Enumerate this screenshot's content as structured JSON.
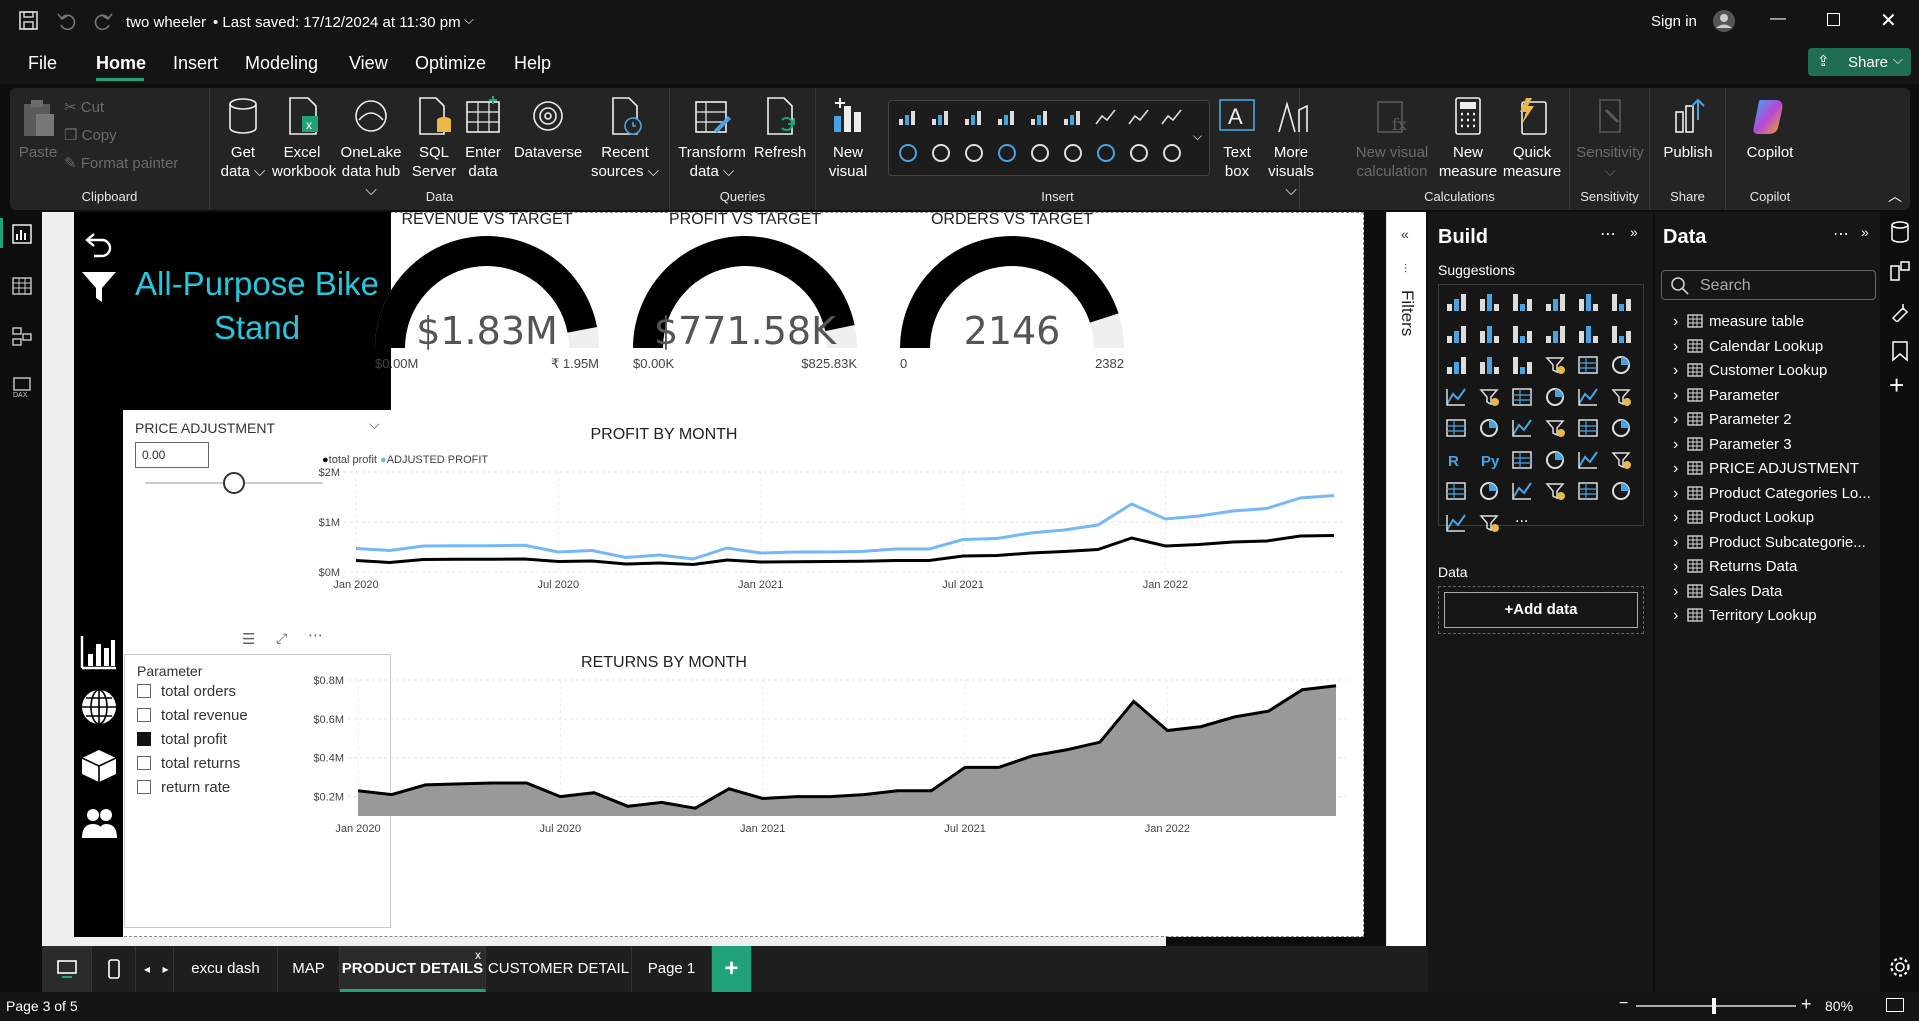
{
  "titlebar": {
    "file_name": "two wheeler",
    "saved": "• Last saved: 17/12/2024 at 11:30 pm",
    "sign_in": "Sign in"
  },
  "menu": {
    "items": [
      "File",
      "Home",
      "Insert",
      "Modeling",
      "View",
      "Optimize",
      "Help"
    ],
    "active": "Home",
    "share": "Share"
  },
  "ribbon": {
    "clipboard": {
      "paste": "Paste",
      "cut": "Cut",
      "copy": "Copy",
      "format_painter": "Format painter",
      "label": "Clipboard"
    },
    "data": {
      "get_data": [
        "Get",
        "data"
      ],
      "excel": [
        "Excel",
        "workbook"
      ],
      "onelake": [
        "OneLake",
        "data hub"
      ],
      "sql": [
        "SQL",
        "Server"
      ],
      "enter": [
        "Enter",
        "data"
      ],
      "dataverse": "Dataverse",
      "recent": [
        "Recent",
        "sources"
      ],
      "label": "Data"
    },
    "queries": {
      "transform": [
        "Transform",
        "data"
      ],
      "refresh": "Refresh",
      "label": "Queries"
    },
    "insert": {
      "new_visual": [
        "New",
        "visual"
      ],
      "text_box": [
        "Text",
        "box"
      ],
      "more_visuals": [
        "More",
        "visuals"
      ],
      "label": "Insert"
    },
    "calculations": {
      "new_visual_calc": [
        "New visual",
        "calculation"
      ],
      "new_measure": [
        "New",
        "measure"
      ],
      "quick_measure": [
        "Quick",
        "measure"
      ],
      "label": "Calculations"
    },
    "sensitivity": {
      "btn": "Sensitivity",
      "label": "Sensitivity"
    },
    "share": {
      "publish": "Publish",
      "label": "Share"
    },
    "copilot": {
      "btn": "Copilot",
      "label": "Copilot"
    }
  },
  "report": {
    "product_title": "All-Purpose Bike Stand",
    "slicer": {
      "title": "PRICE ADJUSTMENT",
      "value": "0.00",
      "level": 0.5
    },
    "parameter": {
      "title": "Parameter",
      "options": [
        {
          "label": "total orders",
          "checked": false
        },
        {
          "label": "total revenue",
          "checked": false
        },
        {
          "label": "total profit",
          "checked": true
        },
        {
          "label": "total returns",
          "checked": false
        },
        {
          "label": "return rate",
          "checked": false
        }
      ]
    },
    "gauges": [
      {
        "title": "REVENUE VS TARGET",
        "value_text": "$1.83M",
        "min": "$0.00M",
        "max": "₹ 1.95M",
        "fraction": 0.94
      },
      {
        "title": "PROFIT VS TARGET",
        "value_text": "$771.58K",
        "min": "$0.00K",
        "max": "$825.83K",
        "fraction": 0.934
      },
      {
        "title": "ORDERS VS TARGET",
        "value_text": "2146",
        "min": "0",
        "max": "2382",
        "fraction": 0.9
      }
    ]
  },
  "chart_data": [
    {
      "type": "line",
      "title": "PROFIT BY MONTH",
      "x": [
        "Jan 2020",
        "Feb 2020",
        "Mar 2020",
        "Apr 2020",
        "May 2020",
        "Jun 2020",
        "Jul 2020",
        "Aug 2020",
        "Sep 2020",
        "Oct 2020",
        "Nov 2020",
        "Dec 2020",
        "Jan 2021",
        "Feb 2021",
        "Mar 2021",
        "Apr 2021",
        "May 2021",
        "Jun 2021",
        "Jul 2021",
        "Aug 2021",
        "Sep 2021",
        "Oct 2021",
        "Nov 2021",
        "Dec 2021",
        "Jan 2022",
        "Feb 2022",
        "Mar 2022",
        "Apr 2022",
        "May 2022",
        "Jun 2022"
      ],
      "x_ticks": [
        "Jan 2020",
        "Jul 2020",
        "Jan 2021",
        "Jul 2021",
        "Jan 2022"
      ],
      "y_ticks": [
        "$0M",
        "$1M",
        "$2M"
      ],
      "ylim": [
        0,
        2000000
      ],
      "legend_position": "top-left",
      "series": [
        {
          "name": "total profit",
          "color": "#000000",
          "values": [
            230000,
            190000,
            250000,
            255000,
            255000,
            260000,
            210000,
            220000,
            160000,
            180000,
            150000,
            240000,
            200000,
            205000,
            210000,
            215000,
            230000,
            230000,
            320000,
            330000,
            380000,
            410000,
            450000,
            680000,
            520000,
            550000,
            600000,
            620000,
            720000,
            730000
          ]
        },
        {
          "name": "ADJUSTED PROFIT",
          "color": "#75b8f5",
          "values": [
            470000,
            430000,
            520000,
            525000,
            525000,
            535000,
            400000,
            430000,
            290000,
            340000,
            260000,
            480000,
            380000,
            400000,
            400000,
            410000,
            460000,
            460000,
            650000,
            670000,
            780000,
            840000,
            940000,
            1360000,
            1060000,
            1120000,
            1220000,
            1270000,
            1480000,
            1530000
          ]
        }
      ]
    },
    {
      "type": "area",
      "title": "RETURNS BY MONTH",
      "x": [
        "Jan 2020",
        "Feb 2020",
        "Mar 2020",
        "Apr 2020",
        "May 2020",
        "Jun 2020",
        "Jul 2020",
        "Aug 2020",
        "Sep 2020",
        "Oct 2020",
        "Nov 2020",
        "Dec 2020",
        "Jan 2021",
        "Feb 2021",
        "Mar 2021",
        "Apr 2021",
        "May 2021",
        "Jun 2021",
        "Jul 2021",
        "Aug 2021",
        "Sep 2021",
        "Oct 2021",
        "Nov 2021",
        "Dec 2021",
        "Jan 2022",
        "Feb 2022",
        "Mar 2022",
        "Apr 2022",
        "May 2022",
        "Jun 2022"
      ],
      "x_ticks": [
        "Jan 2020",
        "Jul 2020",
        "Jan 2021",
        "Jul 2021",
        "Jan 2022"
      ],
      "y_ticks": [
        "$0.2M",
        "$0.4M",
        "$0.6M",
        "$0.8M"
      ],
      "ylim": [
        0.1,
        0.8
      ],
      "series": [
        {
          "name": "",
          "color": "#999999",
          "values": [
            0.23,
            0.21,
            0.26,
            0.265,
            0.27,
            0.27,
            0.2,
            0.22,
            0.15,
            0.17,
            0.14,
            0.24,
            0.19,
            0.2,
            0.2,
            0.21,
            0.23,
            0.23,
            0.35,
            0.35,
            0.41,
            0.44,
            0.48,
            0.69,
            0.54,
            0.56,
            0.61,
            0.64,
            0.75,
            0.77
          ]
        }
      ]
    }
  ],
  "build": {
    "title": "Build",
    "suggestions": "Suggestions",
    "data_label": "Data",
    "add_data": "+Add data"
  },
  "data_pane": {
    "title": "Data",
    "search_placeholder": "Search",
    "tables": [
      "measure table",
      "Calendar Lookup",
      "Customer Lookup",
      "Parameter",
      "Parameter 2",
      "Parameter 3",
      "PRICE ADJUSTMENT",
      "Product Categories Lo...",
      "Product Lookup",
      "Product Subcategorie...",
      "Returns Data",
      "Sales Data",
      "Territory Lookup"
    ]
  },
  "filters": {
    "label": "Filters"
  },
  "tabs": {
    "items": [
      "excu dash",
      "MAP",
      "PRODUCT DETAILS",
      "CUSTOMER DETAIL",
      "Page 1"
    ],
    "active": "PRODUCT DETAILS",
    "add": "+"
  },
  "status": {
    "page": "Page 3 of 5",
    "zoom": "80%"
  },
  "colors": {
    "accent_teal": "#21a37a",
    "title_cyan": "#27c6dc",
    "adjusted_blue": "#75b8f5"
  }
}
